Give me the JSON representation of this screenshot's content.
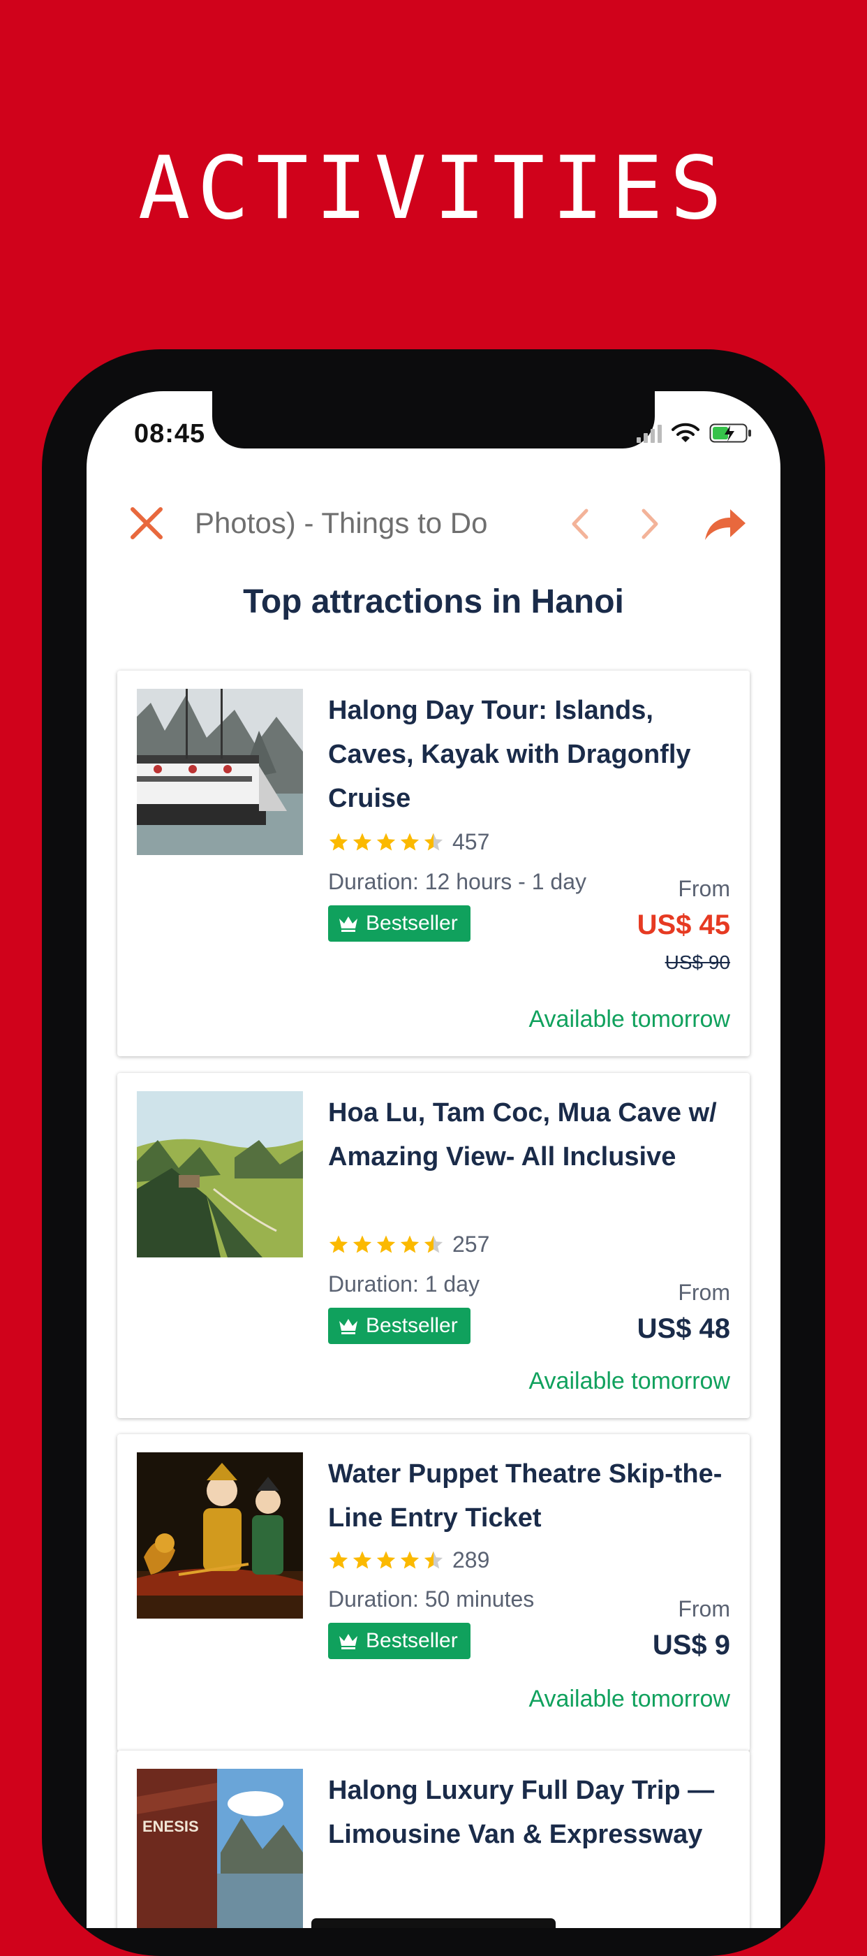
{
  "banner": {
    "title": "ACTIVITIES",
    "background": "#d0021b"
  },
  "status_bar": {
    "time": "08:45"
  },
  "toolbar": {
    "url_text": "h Photos) - Things to Do",
    "close_icon": "close-icon",
    "back_icon": "chevron-left-icon",
    "forward_icon": "chevron-right-icon",
    "share_icon": "share-icon",
    "accent": "#e8683d"
  },
  "page": {
    "heading": "Top attractions in Hanoi"
  },
  "cards": [
    {
      "title": "Halong Day Tour: Islands, Caves, Kayak with Dragonfly Cruise",
      "stars": 4.5,
      "reviews": "457",
      "duration": "Duration: 12 hours - 1 day",
      "badge": "Bestseller",
      "from": "From",
      "price": "US$ 45",
      "original_price": "US$ 90",
      "availability": "Available tomorrow"
    },
    {
      "title": "Hoa Lu, Tam Coc, Mua Cave w/ Amazing View- All Inclusive",
      "stars": 4.5,
      "reviews": "257",
      "duration": "Duration: 1 day",
      "badge": "Bestseller",
      "from": "From",
      "price": "US$ 48",
      "availability": "Available tomorrow"
    },
    {
      "title": "Water Puppet Theatre Skip-the-Line Entry Ticket",
      "stars": 4.5,
      "reviews": "289",
      "duration": "Duration: 50 minutes",
      "badge": "Bestseller",
      "from": "From",
      "price": "US$ 9",
      "availability": "Available tomorrow"
    },
    {
      "title": "Halong Luxury Full Day Trip — Limousine Van & Expressway"
    }
  ]
}
